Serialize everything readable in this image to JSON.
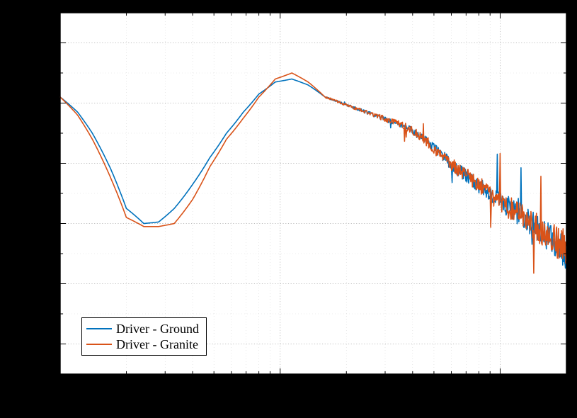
{
  "chart_data": {
    "type": "line",
    "xlabel": "",
    "ylabel": "",
    "title": "",
    "x_scale": "log",
    "xlim": [
      10,
      2000
    ],
    "ylim": [
      -90,
      30
    ],
    "y_major_ticks": [
      -80,
      -60,
      -40,
      -20,
      0,
      20
    ],
    "y_minor_step": 10,
    "x_decade_anchors": [
      10,
      100,
      1000
    ],
    "series": [
      {
        "name": "Driver - Ground",
        "color": "#0072BD",
        "x": [
          10,
          12,
          14,
          17,
          20,
          24,
          28,
          33,
          40,
          48,
          57,
          68,
          80,
          95,
          113,
          134,
          160,
          190,
          225,
          268,
          318,
          378,
          450,
          535,
          636,
          756,
          900,
          1070,
          1272,
          1512,
          1800,
          2000
        ],
        "y": [
          2,
          -3,
          -10,
          -22,
          -35,
          -40,
          -39.5,
          -35,
          -27,
          -18,
          -10,
          -3,
          3,
          7,
          8,
          6,
          2,
          0,
          -2,
          -4,
          -6,
          -8,
          -12,
          -17,
          -22,
          -26,
          -30,
          -34,
          -38,
          -42,
          -47,
          -50
        ]
      },
      {
        "name": "Driver - Granite",
        "color": "#D95319",
        "x": [
          10,
          12,
          14,
          17,
          20,
          24,
          28,
          33,
          40,
          48,
          57,
          68,
          80,
          95,
          113,
          134,
          160,
          190,
          225,
          268,
          318,
          378,
          450,
          535,
          636,
          756,
          900,
          1070,
          1272,
          1512,
          1800,
          2000
        ],
        "y": [
          2,
          -4,
          -12,
          -25,
          -38,
          -41,
          -41,
          -40,
          -32,
          -21,
          -12,
          -5,
          2,
          8,
          10,
          7,
          2,
          0,
          -2,
          -4,
          -6,
          -8,
          -12,
          -17,
          -22,
          -26,
          -30,
          -34,
          -38,
          -42,
          -46,
          -48
        ]
      }
    ],
    "noise": {
      "start_x": 160,
      "base_amp": 0.6,
      "peak_amp": 10,
      "series_extra": [
        0,
        1.2
      ]
    }
  },
  "legend": {
    "items": [
      {
        "label": "Driver - Ground",
        "color": "#0072BD"
      },
      {
        "label": "Driver - Granite",
        "color": "#D95319"
      }
    ]
  }
}
